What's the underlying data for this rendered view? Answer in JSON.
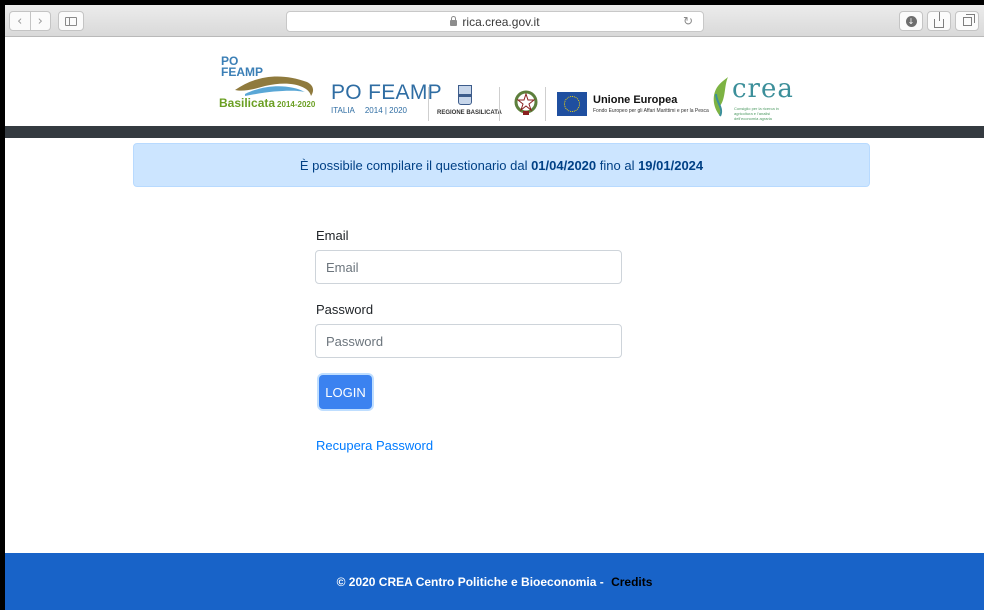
{
  "browser": {
    "url": "rica.crea.gov.it",
    "nav_back_icon": "chevron-left-icon",
    "nav_forward_icon": "chevron-right-icon",
    "reload_icon": "reload-icon",
    "back_glyph": "‹",
    "forward_glyph": "›",
    "reload_glyph": "↻",
    "download_glyph": "↓"
  },
  "header": {
    "feamp_basilicata": {
      "po": "PO",
      "feamp": "FEAMP",
      "name": "Basilicata",
      "years": "2014-2020"
    },
    "po_feamp": {
      "title": "PO FEAMP",
      "country": "ITALIA",
      "period": "2014 | 2020"
    },
    "regione_label": "REGIONE BASILICATA",
    "eu": {
      "title": "Unione Europea",
      "subtitle": "Fondo Europeo per gli Affari Marittimi e per la Pesca"
    },
    "crea": {
      "word": "crea",
      "subtitle": "Consiglio per la ricerca in agricoltura e l'analisi dell'economia agraria"
    }
  },
  "alert": {
    "prefix": "È possibile compilare il questionario dal ",
    "start_date": "01/04/2020",
    "middle": " fino al ",
    "end_date": "19/01/2024"
  },
  "form": {
    "email_label": "Email",
    "email_placeholder": "Email",
    "email_value": "",
    "password_label": "Password",
    "password_placeholder": "Password",
    "password_value": "",
    "login_label": "LOGIN",
    "recover_label": "Recupera Password"
  },
  "footer": {
    "text": "© 2020 CREA Centro Politiche e Bioeconomia - ",
    "credits": "Credits"
  },
  "colors": {
    "alert_bg": "#cce5ff",
    "button": "#3b82f0",
    "link": "#007bff",
    "footer_bg": "#1863c8",
    "navbar": "#343a40"
  }
}
